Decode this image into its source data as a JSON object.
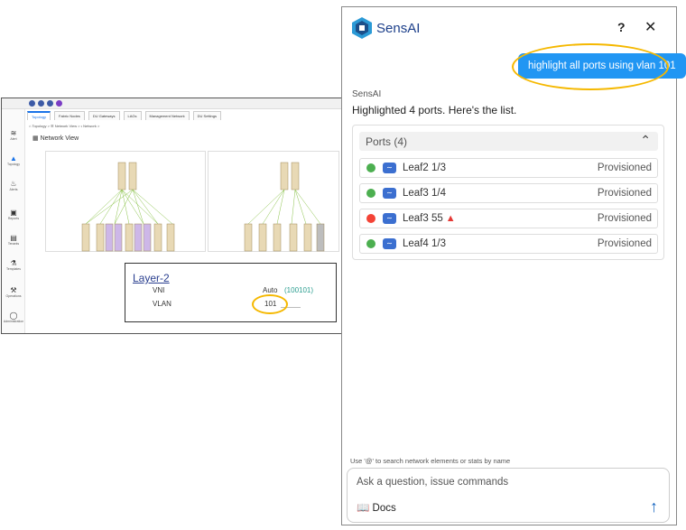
{
  "embedded_screenshot": {
    "tabs": [
      "Topology",
      "Fabric Nodes",
      "DU Gateways",
      "LAGs",
      "Management Network",
      "DU Settings"
    ],
    "breadcrumb": "⌂ Topology  >  ☰ Network View  >  • Network  >",
    "view_title": "Network View",
    "sidebar": [
      "Alert",
      "Topology",
      "Alerts",
      "Reports",
      "Tenants",
      "Templates",
      "Operations",
      "Administration"
    ],
    "layer2": {
      "title": "Layer-2",
      "vni_label": "VNI",
      "vni_value": "Auto",
      "vni_id": "(100101)",
      "vlan_label": "VLAN",
      "vlan_value": "101"
    }
  },
  "chat": {
    "app_name": "SensAI",
    "help_label": "?",
    "close_label": "✕",
    "user_message": "highlight all ports using vlan 101",
    "sender": "SensAI",
    "reply": "Highlighted 4 ports. Here's the list.",
    "ports_header": "Ports (4)",
    "ports": [
      {
        "name": "Leaf2 1/3",
        "status": "Provisioned",
        "dot_color": "#4caf50",
        "warning": ""
      },
      {
        "name": "Leaf3 1/4",
        "status": "Provisioned",
        "dot_color": "#4caf50",
        "warning": ""
      },
      {
        "name": "Leaf3 55",
        "status": "Provisioned",
        "dot_color": "#f44336",
        "warning": "▲"
      },
      {
        "name": "Leaf4 1/3",
        "status": "Provisioned",
        "dot_color": "#4caf50",
        "warning": ""
      }
    ],
    "hint": "Use '@' to search network elements or stats by name",
    "input_placeholder": "Ask a question, issue commands",
    "docs_label": "Docs",
    "send_icon": "arrow-up-icon",
    "accent": "#2196f3",
    "highlight": "#f5b800"
  }
}
